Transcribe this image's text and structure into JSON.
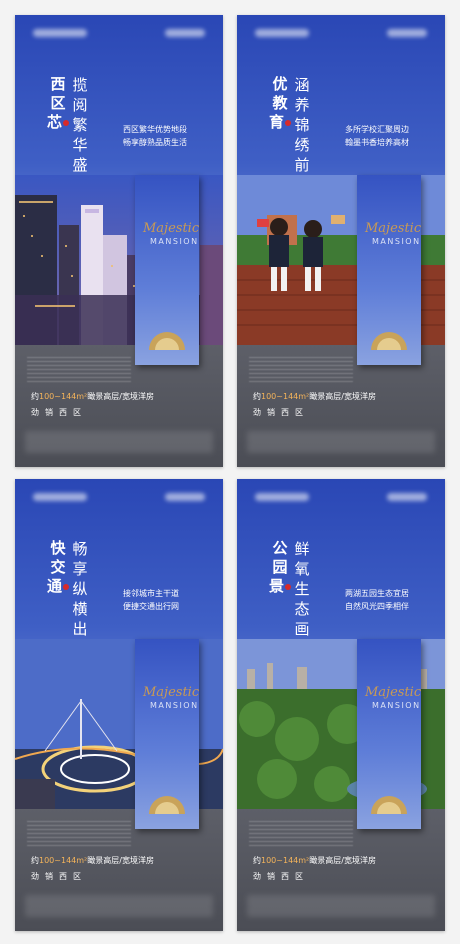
{
  "posters": [
    {
      "short_title": "西区芯",
      "long_title": "揽阅繁华盛境",
      "subtitle_lines": [
        "西区繁华优势地段",
        "畅享醇熟品质生活"
      ],
      "brand_script": "Majestic",
      "brand_name": "MANSION",
      "promo_prefix": "约",
      "promo_highlight": "100~144m²",
      "promo_suffix": "瞰景高层/宽境洋房",
      "promo_slogan": "劲销西区"
    },
    {
      "short_title": "优教育",
      "long_title": "涵养锦绣前程",
      "subtitle_lines": [
        "多所学校汇聚周边",
        "翰墨书香培养高材"
      ],
      "brand_script": "Majestic",
      "brand_name": "MANSION",
      "promo_prefix": "约",
      "promo_highlight": "100~144m²",
      "promo_suffix": "瞰景高层/宽境洋房",
      "promo_slogan": "劲销西区"
    },
    {
      "short_title": "快交通",
      "long_title": "畅享纵横出行",
      "subtitle_lines": [
        "接邻城市主干道",
        "便捷交通出行网"
      ],
      "brand_script": "Majestic",
      "brand_name": "MANSION",
      "promo_prefix": "约",
      "promo_highlight": "100~144m²",
      "promo_suffix": "瞰景高层/宽境洋房",
      "promo_slogan": "劲销西区"
    },
    {
      "short_title": "公园景",
      "long_title": "鲜氧生态画境",
      "subtitle_lines": [
        "两湖五园生态宜居",
        "自然风光四季相伴"
      ],
      "brand_script": "Majestic",
      "brand_name": "MANSION",
      "promo_prefix": "约",
      "promo_highlight": "100~144m²",
      "promo_suffix": "瞰景高层/宽境洋房",
      "promo_slogan": "劲销西区"
    }
  ],
  "colors": {
    "sky_top": "#2a47b5",
    "accent_gold": "#c89a55",
    "promo_highlight": "#f5b45a",
    "dot_red": "#d72a2a",
    "bottom_gray": "#55575f"
  }
}
